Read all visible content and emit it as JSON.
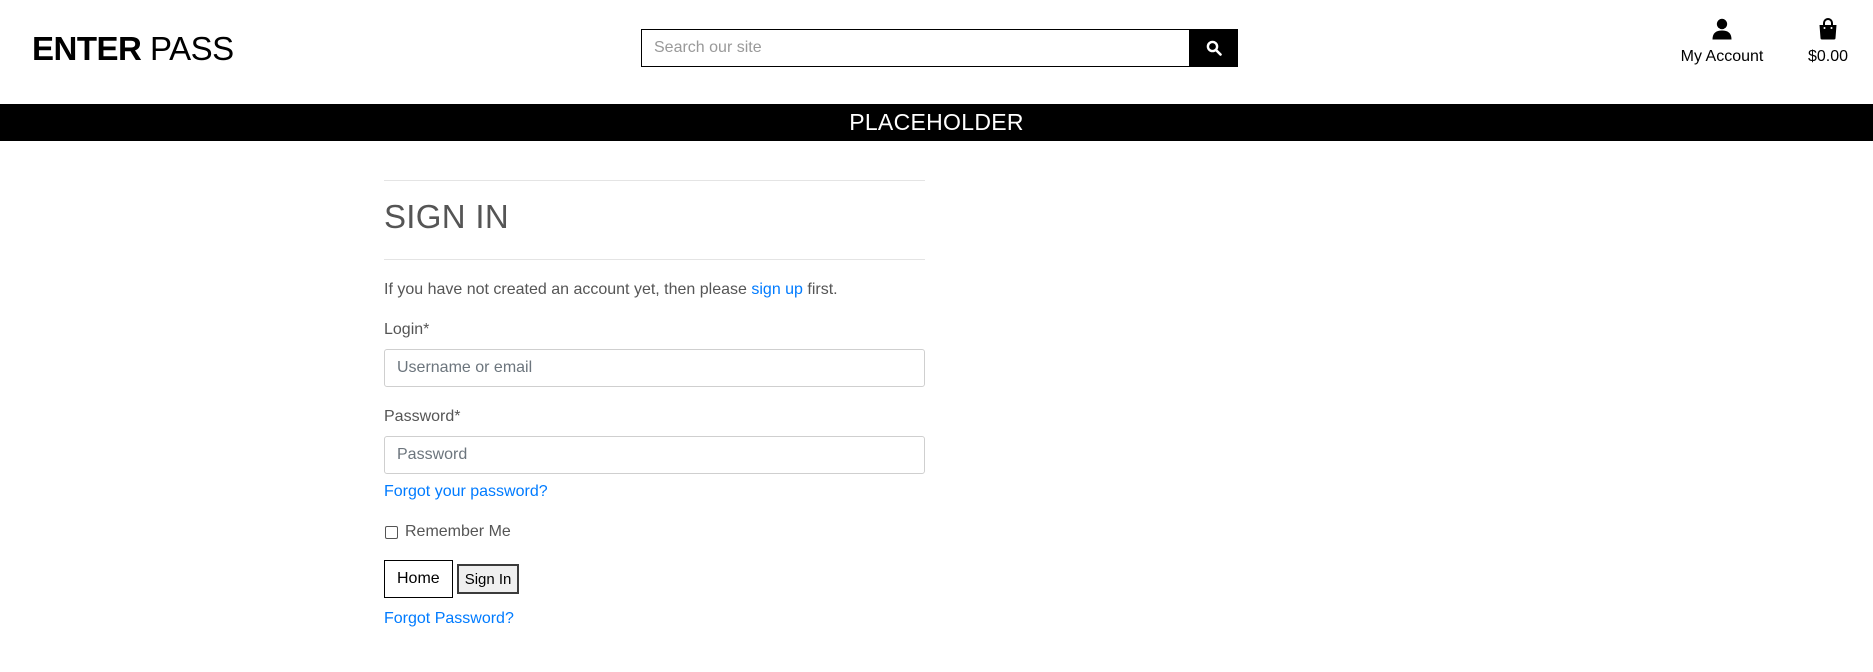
{
  "header": {
    "logo_bold": "ENTER",
    "logo_light": "PASS",
    "search": {
      "placeholder": "Search our site",
      "icon": "search-icon"
    },
    "account": {
      "label": "My Account",
      "icon": "user-icon"
    },
    "bag": {
      "label": "$0.00",
      "icon": "shopping-bag-icon"
    }
  },
  "banner": {
    "text": "PLACEHOLDER"
  },
  "signin": {
    "title": "SIGN IN",
    "intro_before": "If you have not created an account yet, then please ",
    "intro_link": "sign up",
    "intro_after": " first.",
    "login_label": "Login*",
    "login_placeholder": "Username or email",
    "password_label": "Password*",
    "password_placeholder": "Password",
    "forgot_link": "Forgot your password?",
    "remember_label": "Remember Me",
    "home_button": "Home",
    "signin_button": "Sign In",
    "forgot_link_2": "Forgot Password?"
  },
  "colors": {
    "link": "#007bff",
    "banner_bg": "#000000",
    "banner_text": "#ffffff"
  }
}
